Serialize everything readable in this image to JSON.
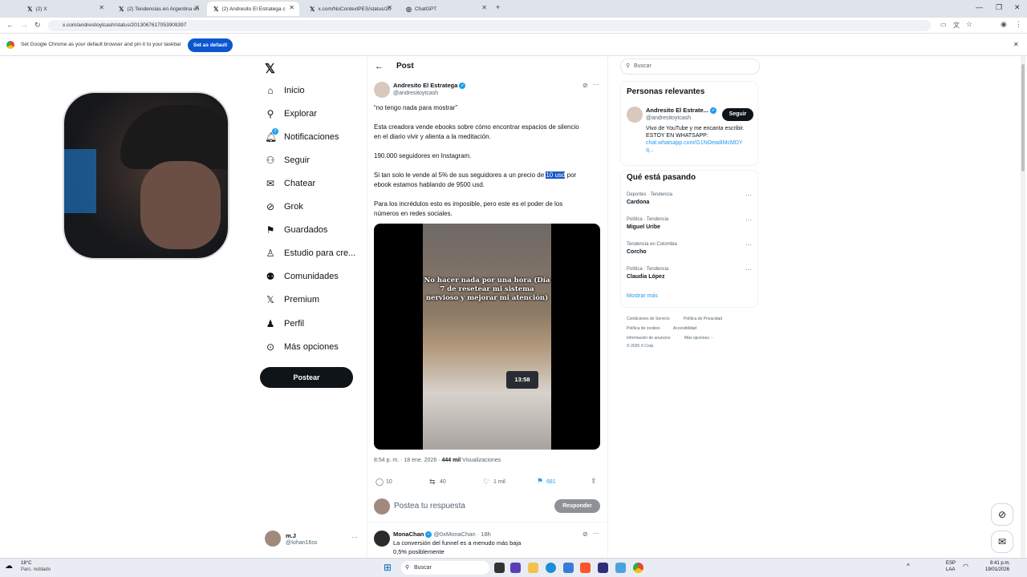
{
  "browser": {
    "tabs": [
      {
        "title": "(2) X"
      },
      {
        "title": "(2) Tendencias en Argentina en"
      },
      {
        "title": "(2) Andresito El Estratega c"
      },
      {
        "title": "x.com/NoContextPES/status/20"
      },
      {
        "title": "ChatGPT"
      }
    ],
    "url": "x.com/andresitoytcash/status/2013067617053909397",
    "infobar_message": "Set Google Chrome as your default browser and pin it to your taskbar",
    "infobar_button": "Set as default"
  },
  "sidebar": {
    "items": [
      {
        "label": "Inicio",
        "icon": "home-icon"
      },
      {
        "label": "Explorar",
        "icon": "search-icon"
      },
      {
        "label": "Notificaciones",
        "icon": "bell-icon",
        "badge": "2"
      },
      {
        "label": "Seguir",
        "icon": "add-person-icon"
      },
      {
        "label": "Chatear",
        "icon": "envelope-icon"
      },
      {
        "label": "Grok",
        "icon": "grok-icon"
      },
      {
        "label": "Guardados",
        "icon": "bookmark-icon"
      },
      {
        "label": "Estudio para cre...",
        "icon": "studio-icon"
      },
      {
        "label": "Comunidades",
        "icon": "people-icon"
      },
      {
        "label": "Premium",
        "icon": "x-icon"
      },
      {
        "label": "Perfil",
        "icon": "person-icon"
      },
      {
        "label": "Más opciones",
        "icon": "more-icon"
      }
    ],
    "post_button": "Postear",
    "user": {
      "name": "m.J",
      "handle": "@Iohan16ss"
    }
  },
  "post": {
    "header_title": "Post",
    "author_name": "Andresito El Estratega",
    "author_handle": "@andresitoytcash",
    "p1": "“no tengo nada para mostrar”",
    "p2a": "Esta creadora vende ebooks sobre cómo encontrar espacios de silencio",
    "p2b": "en el diario vivir y alienta a la meditación.",
    "p3": "190.000 seguidores en Instagram.",
    "p4a": "Si tan solo le vende al 5% de sus seguidores a un precio de ",
    "p4hl": "10 usd",
    "p4b": " por",
    "p4c": "ebook estamos hablando de 9500 usd.",
    "p5a": "Para los incrédulos esto es imposible, pero este es el poder de los",
    "p5b": "números en redes sociales.",
    "media_caption": "No hacer nada por una hora (Día 7 de resetear mi sistema nervioso y mejorar mi atención)",
    "media_clock": "13:58",
    "timestamp": "8:54 p. m. · 18 ene. 2026 · ",
    "views_count": "444 mil",
    "views_label": " Visualizaciones",
    "stats": {
      "replies": "10",
      "reposts": "40",
      "likes": "1 mil",
      "bookmarks": "681"
    },
    "reply_placeholder": "Postea tu respuesta",
    "reply_button": "Responder"
  },
  "reply": {
    "name": "MonaChan",
    "handle": "@0xMonaChan · 18h",
    "line1": "La conversión del funnel es a menudo más baja",
    "line2": "0,5% posiblemente"
  },
  "right": {
    "search_placeholder": "Buscar",
    "relevant_title": "Personas relevantes",
    "person": {
      "name": "Andresito El Estrate...",
      "handle": "@andresitoytcash",
      "follow": "Seguir",
      "bio1": "Vivo de YouTube y me encanta escribir.",
      "bio2": "ESTOY EN WHATSAPP:",
      "link1": "chat.whatsapp.com/G1NOeadIMcMDY",
      "link2": "q..."
    },
    "trends_title": "Qué está pasando",
    "trends": [
      {
        "context": "Deportes · Tendencia",
        "name": "Cardona"
      },
      {
        "context": "Política · Tendencia",
        "name": "Miguel Uribe"
      },
      {
        "context": "Tendencia en Colombia",
        "name": "Corcho"
      },
      {
        "context": "Política · Tendencia",
        "name": "Claudia López"
      }
    ],
    "show_more": "Mostrar más",
    "footer": {
      "l1": "Condiciones de Servicio",
      "l2": "Política de Privacidad",
      "l3": "Política de cookies",
      "l4": "Accesibilidad",
      "l5": "Información de anuncios",
      "l6": "Más opciones ···",
      "copy": "© 2026 X Corp."
    }
  },
  "taskbar": {
    "weather_temp": "18°C",
    "weather_desc": "Parc. nublado",
    "search": "Buscar",
    "lang1": "ESP",
    "lang2": "LAA",
    "time": "8:41 p.m.",
    "date": "19/01/2026"
  }
}
